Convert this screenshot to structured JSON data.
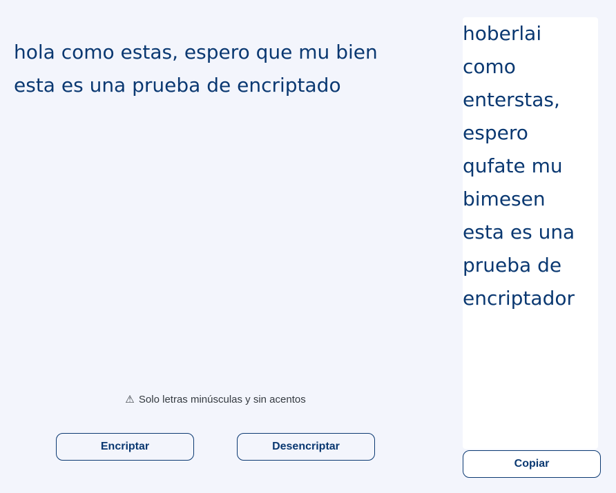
{
  "input": {
    "value": "hola como estas, espero que mu bien\nesta es una prueba de encriptado"
  },
  "warning": {
    "icon": "warning-triangle-icon",
    "icon_glyph": "⚠",
    "text": "Solo letras minúsculas y sin acentos"
  },
  "actions": {
    "encrypt_label": "Encriptar",
    "decrypt_label": "Desencriptar"
  },
  "output": {
    "text": "hoberlai\ncomo\nenterstas,\nespero\nqufate mu\nbimesen\nesta es una\nprueba de\nencriptador",
    "copy_label": "Copiar"
  },
  "colors": {
    "background": "#f3f5fc",
    "accent": "#0a3871",
    "panel": "#ffffff"
  }
}
